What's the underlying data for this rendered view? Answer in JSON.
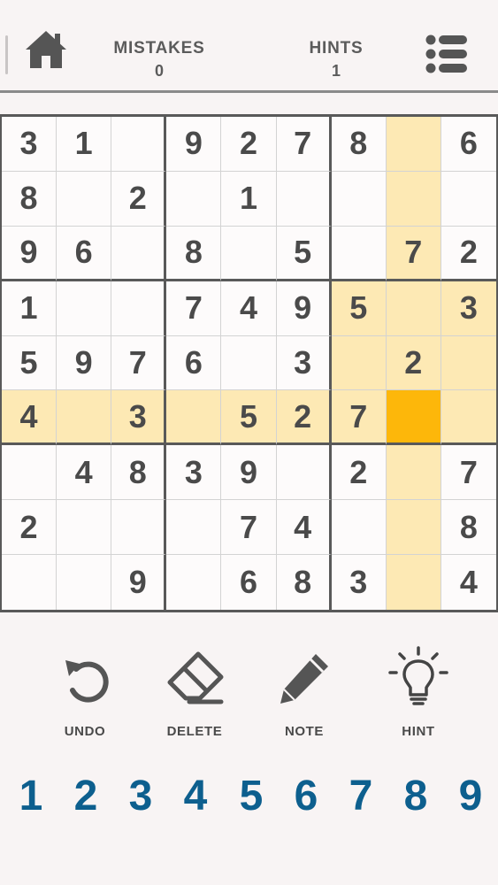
{
  "header": {
    "mistakes_label": "MISTAKES",
    "mistakes_value": "0",
    "hints_label": "HINTS",
    "hints_value": "1",
    "home_icon": "home-icon",
    "menu_icon": "list-menu-icon"
  },
  "board": {
    "cells": [
      [
        "3",
        "1",
        "",
        "9",
        "2",
        "7",
        "8",
        "",
        "6"
      ],
      [
        "8",
        "",
        "2",
        "",
        "1",
        "",
        "",
        "",
        ""
      ],
      [
        "9",
        "6",
        "",
        "8",
        "",
        "5",
        "",
        "7",
        "2"
      ],
      [
        "1",
        "",
        "",
        "7",
        "4",
        "9",
        "5",
        "",
        "3"
      ],
      [
        "5",
        "9",
        "7",
        "6",
        "",
        "3",
        "",
        "2",
        ""
      ],
      [
        "4",
        "",
        "3",
        "",
        "5",
        "2",
        "7",
        "",
        ""
      ],
      [
        "",
        "4",
        "8",
        "3",
        "9",
        "",
        "2",
        "",
        "7"
      ],
      [
        "2",
        "",
        "",
        "",
        "7",
        "4",
        "",
        "",
        "8"
      ],
      [
        "",
        "",
        "9",
        "",
        "6",
        "8",
        "3",
        "",
        "4"
      ]
    ],
    "selected": {
      "row": 5,
      "col": 7
    },
    "highlight_color": "#fde9b4",
    "selected_color": "#fdb70a"
  },
  "tools": {
    "undo_label": "UNDO",
    "delete_label": "DELETE",
    "note_label": "NOTE",
    "hint_label": "HINT"
  },
  "numpad": [
    "1",
    "2",
    "3",
    "4",
    "5",
    "6",
    "7",
    "8",
    "9"
  ],
  "colors": {
    "numpad": "#0d5f8e",
    "background": "#f8f4f4"
  }
}
